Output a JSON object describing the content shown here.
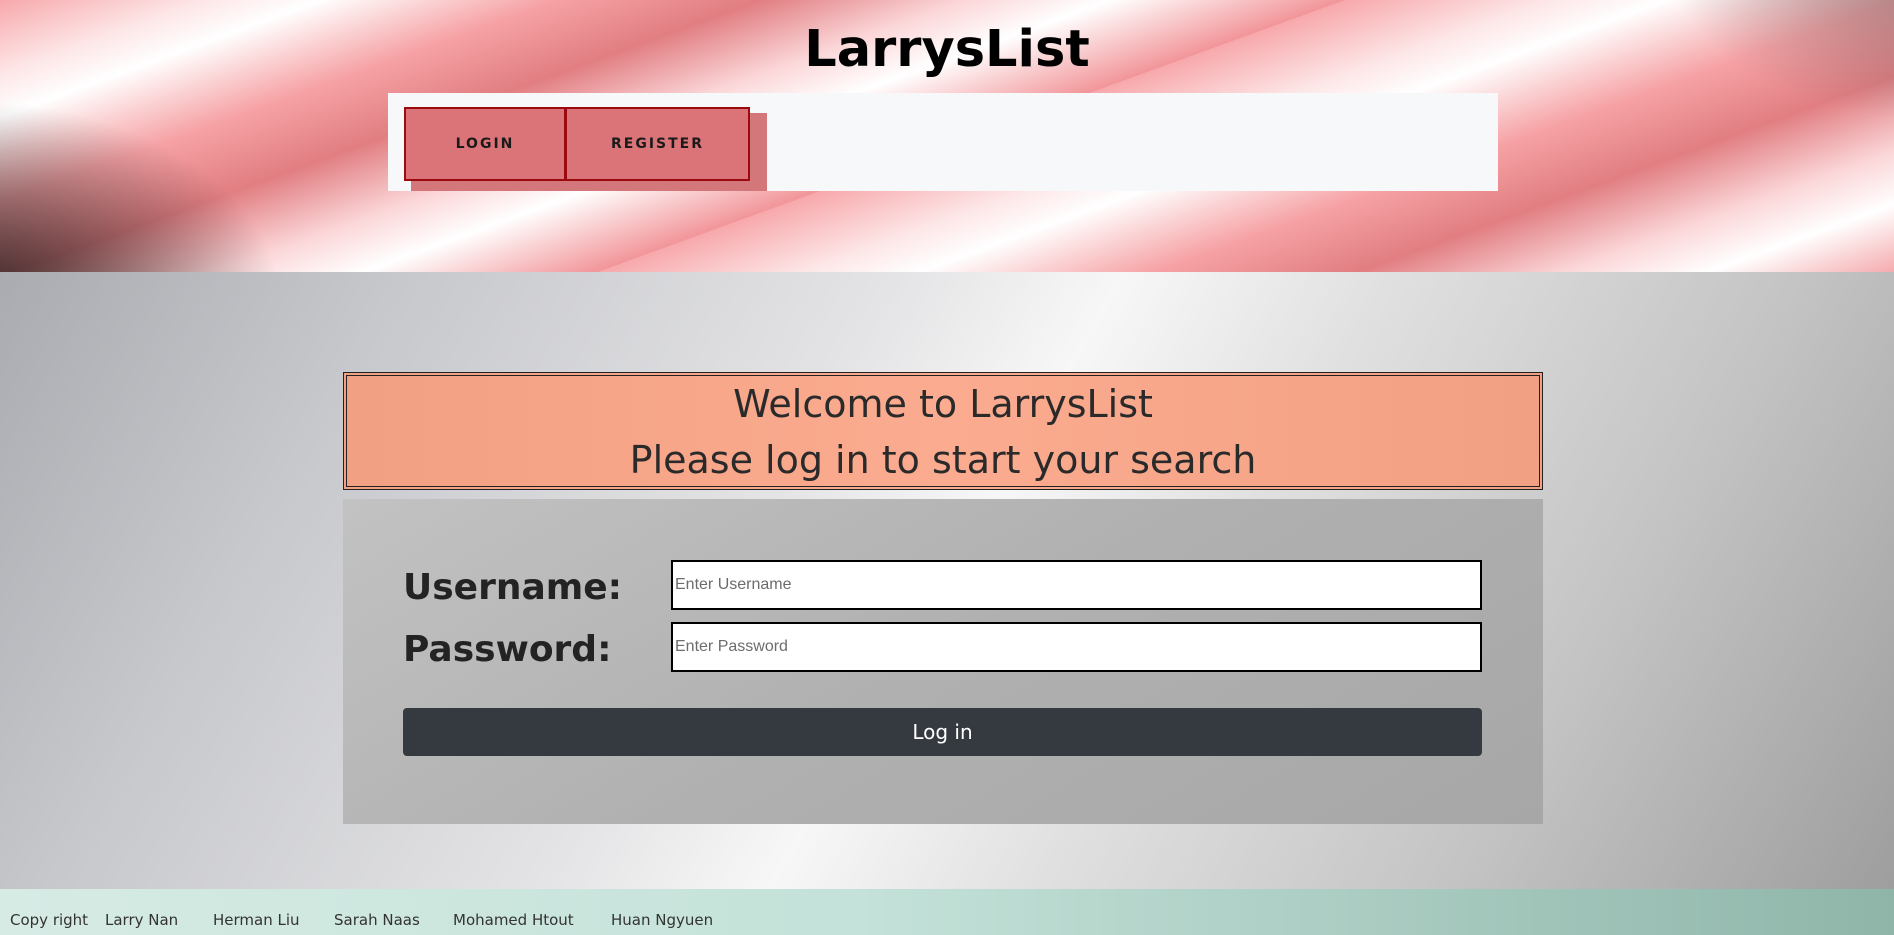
{
  "header": {
    "title": "LarrysList",
    "nav": {
      "login_label": "LOGIN",
      "register_label": "REGISTER"
    }
  },
  "main": {
    "welcome_line1": "Welcome to LarrysList",
    "welcome_line2": "Please log in to start your search",
    "form": {
      "username_label": "Username:",
      "username_placeholder": "Enter Username",
      "password_label": "Password:",
      "password_placeholder": "Enter Password",
      "submit_label": "Log in"
    }
  },
  "footer": {
    "copyright": "Copy right",
    "authors": [
      "Larry Nan",
      "Herman Liu",
      "Sarah Naas",
      "Mohamed Htout",
      "Huan Ngyuen"
    ]
  },
  "colors": {
    "nav_button": "#db7478",
    "nav_button_border": "#9a0a0f",
    "welcome_bg": "#f9a88b",
    "login_button": "#343a40",
    "footer_bg": "#c4e2d9"
  }
}
